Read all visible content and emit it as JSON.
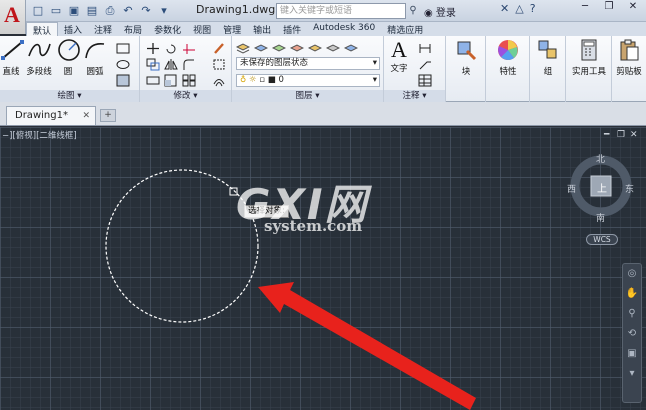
{
  "titlebar": {
    "app_letter": "A",
    "document_title": "Drawing1.dwg",
    "search_placeholder": "键入关键字或短语",
    "login_label": "登录",
    "minimize": "─",
    "restore": "❐",
    "close": "✕"
  },
  "ribbon_tabs": [
    "默认",
    "插入",
    "注释",
    "布局",
    "参数化",
    "视图",
    "管理",
    "输出",
    "插件",
    "Autodesk 360",
    "精选应用"
  ],
  "ribbon": {
    "draw": {
      "label": "绘图 ▾",
      "line": "直线",
      "polyline": "多段线",
      "circle": "圆",
      "arc": "圆弧"
    },
    "modify": {
      "label": "修改 ▾"
    },
    "layers": {
      "label": "图层 ▾",
      "layer_state": "未保存的图层状态",
      "current_layer": "0"
    },
    "annotation": {
      "label": "注释 ▾",
      "text": "文字"
    },
    "block": "块",
    "properties": "特性",
    "groups": "组",
    "utilities": "实用工具",
    "clipboard": "剪贴板"
  },
  "doc_tabs": {
    "active": "Drawing1*"
  },
  "viewport": {
    "label": "−][俯视][二维线框]",
    "compass": {
      "north": "北",
      "south": "南",
      "east": "东",
      "west": "西",
      "top": "上"
    },
    "wcs": "WCS",
    "tooltip": "选择对象:"
  },
  "watermark": {
    "big": "GXI网",
    "small": "system.com"
  },
  "colors": {
    "canvas": "#283039",
    "selection_circle": "#ffffff",
    "arrow": "#e8221c",
    "ribbon_bg": "#eef1f6"
  }
}
